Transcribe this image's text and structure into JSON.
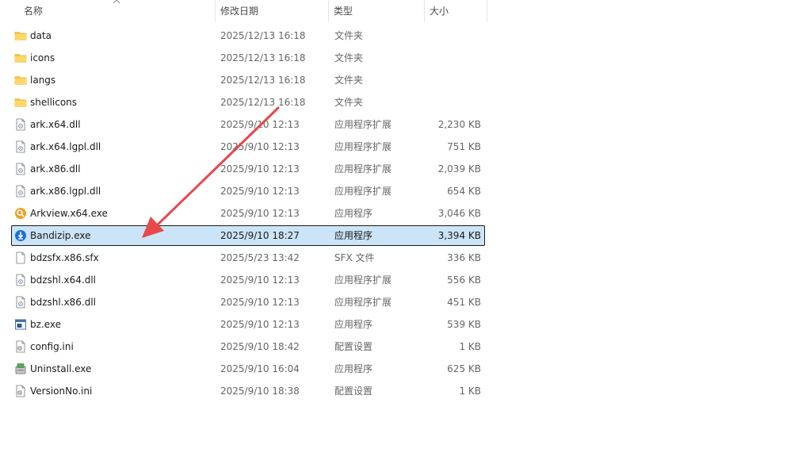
{
  "columns": {
    "name": "名称",
    "date": "修改日期",
    "type": "类型",
    "size": "大小"
  },
  "files": [
    {
      "name": "data",
      "date": "2025/12/13 16:18",
      "type": "文件夹",
      "size": "",
      "icon": "folder-icon"
    },
    {
      "name": "icons",
      "date": "2025/12/13 16:18",
      "type": "文件夹",
      "size": "",
      "icon": "folder-icon"
    },
    {
      "name": "langs",
      "date": "2025/12/13 16:18",
      "type": "文件夹",
      "size": "",
      "icon": "folder-icon"
    },
    {
      "name": "shellicons",
      "date": "2025/12/13 16:18",
      "type": "文件夹",
      "size": "",
      "icon": "folder-icon"
    },
    {
      "name": "ark.x64.dll",
      "date": "2025/9/10 12:13",
      "type": "应用程序扩展",
      "size": "2,230 KB",
      "icon": "dll-file-icon"
    },
    {
      "name": "ark.x64.lgpl.dll",
      "date": "2025/9/10 12:13",
      "type": "应用程序扩展",
      "size": "751 KB",
      "icon": "dll-file-icon"
    },
    {
      "name": "ark.x86.dll",
      "date": "2025/9/10 12:13",
      "type": "应用程序扩展",
      "size": "2,039 KB",
      "icon": "dll-file-icon"
    },
    {
      "name": "ark.x86.lgpl.dll",
      "date": "2025/9/10 12:13",
      "type": "应用程序扩展",
      "size": "654 KB",
      "icon": "dll-file-icon"
    },
    {
      "name": "Arkview.x64.exe",
      "date": "2025/9/10 12:13",
      "type": "应用程序",
      "size": "3,046 KB",
      "icon": "arkview-app-icon"
    },
    {
      "name": "Bandizip.exe",
      "date": "2025/9/10 18:27",
      "type": "应用程序",
      "size": "3,394 KB",
      "icon": "bandizip-app-icon",
      "selected": true
    },
    {
      "name": "bdzsfx.x86.sfx",
      "date": "2025/5/23 13:42",
      "type": "SFX 文件",
      "size": "336 KB",
      "icon": "blank-file-icon"
    },
    {
      "name": "bdzshl.x64.dll",
      "date": "2025/9/10 12:13",
      "type": "应用程序扩展",
      "size": "556 KB",
      "icon": "dll-file-icon"
    },
    {
      "name": "bdzshl.x86.dll",
      "date": "2025/9/10 12:13",
      "type": "应用程序扩展",
      "size": "451 KB",
      "icon": "dll-file-icon"
    },
    {
      "name": "bz.exe",
      "date": "2025/9/10 12:13",
      "type": "应用程序",
      "size": "539 KB",
      "icon": "console-app-icon"
    },
    {
      "name": "config.ini",
      "date": "2025/9/10 18:42",
      "type": "配置设置",
      "size": "1 KB",
      "icon": "ini-file-icon"
    },
    {
      "name": "Uninstall.exe",
      "date": "2025/9/10 16:04",
      "type": "应用程序",
      "size": "625 KB",
      "icon": "installer-app-icon"
    },
    {
      "name": "VersionNo.ini",
      "date": "2025/9/10 18:38",
      "type": "配置设置",
      "size": "1 KB",
      "icon": "ini-file-icon"
    }
  ],
  "colors": {
    "selection_bg": "#cce4f7",
    "folder": "#f5c542",
    "arrow": "#e8484a",
    "bandizip": "#1a73d9"
  }
}
